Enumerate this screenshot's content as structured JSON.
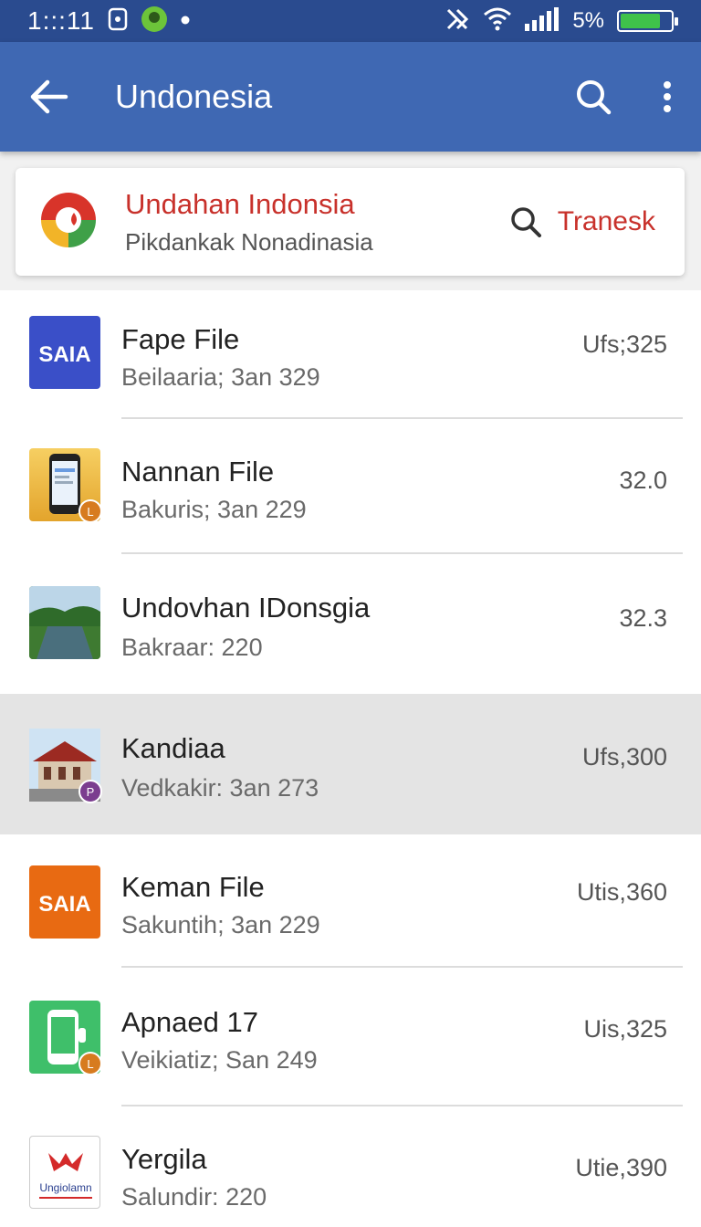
{
  "status": {
    "time": "1:::11",
    "battery_pct": "5%",
    "battery_level": 0.8
  },
  "appbar": {
    "title": "Undonesia",
    "back_icon": "arrow-left-icon",
    "search_icon": "search-icon",
    "more_icon": "more-vert-icon"
  },
  "feature": {
    "title": "Undahan Indonsia",
    "subtitle": "Pikdankak Nonadinasia",
    "action": "Tranesk"
  },
  "items": [
    {
      "title": "Fape File",
      "subtitle": "Beilaaria; 3an 329",
      "value": "Ufs;325",
      "thumb_text": "SAIA"
    },
    {
      "title": "Nannan File",
      "subtitle": "Bakuris; 3an 229",
      "value": "32.0",
      "badge": "L"
    },
    {
      "title": "Undovhan IDonsgia",
      "subtitle": "Bakraar: 220",
      "value": "32.3"
    },
    {
      "title": "Kandiaa",
      "subtitle": "Vedkakir: 3an 273",
      "value": "Ufs,300",
      "badge": "P"
    },
    {
      "title": "Keman File",
      "subtitle": "Sakuntih; 3an 229",
      "value": "Utis,360",
      "thumb_text": "SAIA"
    },
    {
      "title": "Apnaed 17",
      "subtitle": "Veikiatiz; San 249",
      "value": "Uis,325",
      "badge": "L"
    },
    {
      "title": "Yergila",
      "subtitle": "Salundir: 220",
      "value": "Utie,390",
      "thumb_text": "Ungiolamn"
    }
  ],
  "colors": {
    "statusbar": "#2a4b8f",
    "appbar": "#3f68b3",
    "accent": "#c8312b"
  }
}
